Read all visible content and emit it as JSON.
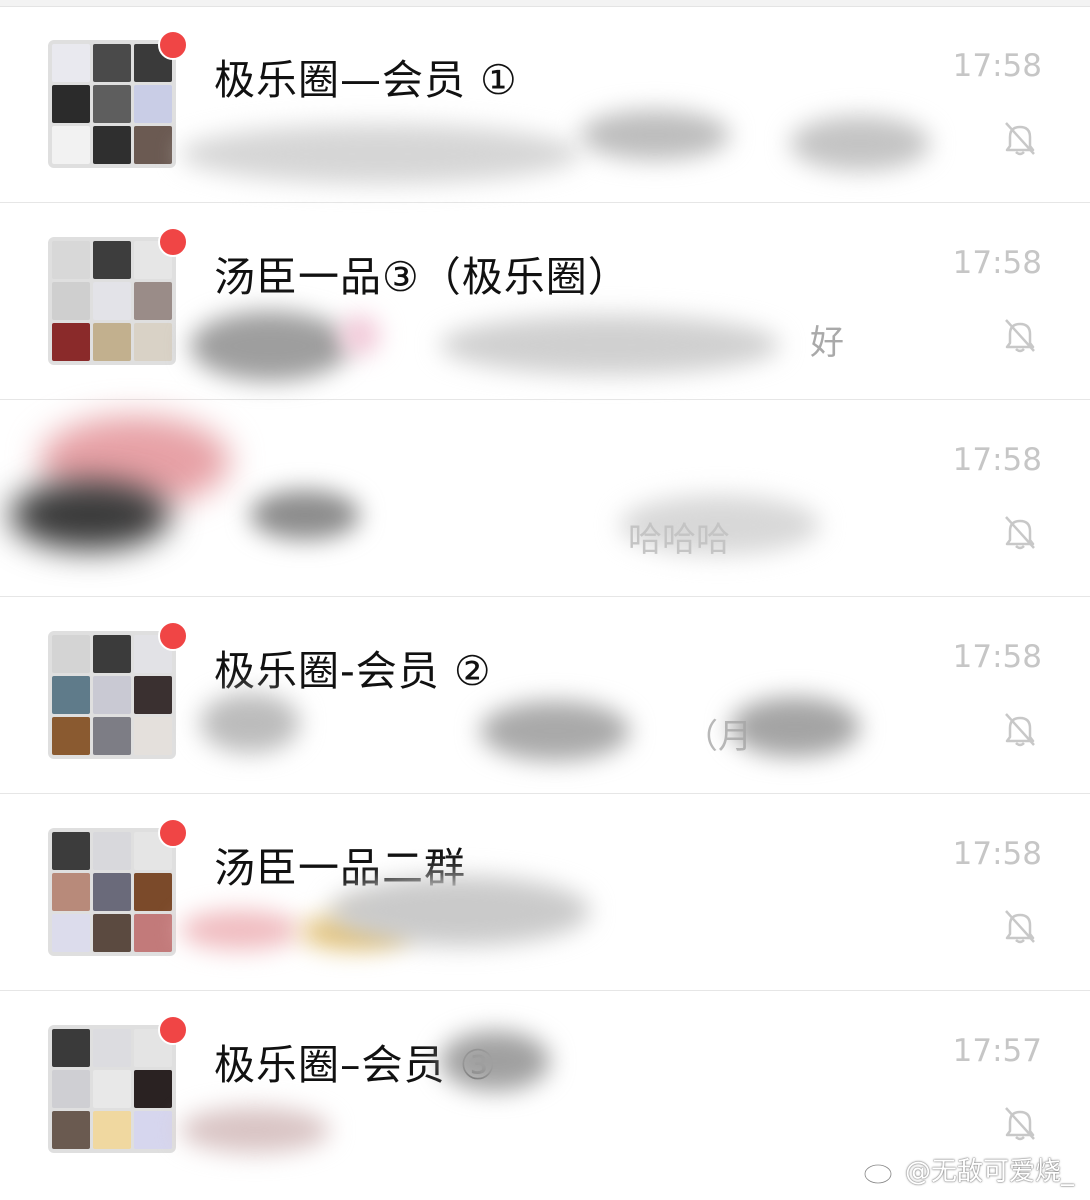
{
  "chats": [
    {
      "title": "极乐圈—会员 ①",
      "time": "17:58",
      "preview": "",
      "unread": true,
      "muted": true
    },
    {
      "title": "汤臣一品③（极乐圈）",
      "time": "17:58",
      "preview": "好",
      "unread": true,
      "muted": true
    },
    {
      "title": "",
      "time": "17:58",
      "preview": "哈哈哈",
      "unread": true,
      "muted": true
    },
    {
      "title": "极乐圈-会员 ②",
      "time": "17:58",
      "preview": "（月",
      "unread": true,
      "muted": true
    },
    {
      "title": "汤臣一品二群",
      "time": "17:58",
      "preview": "",
      "unread": true,
      "muted": true
    },
    {
      "title": "极乐圈–会员 ③",
      "time": "17:57",
      "preview": "",
      "unread": true,
      "muted": true
    }
  ],
  "watermark": "@无敌可爱烧_",
  "colors": {
    "unread_dot": "#f04545",
    "time": "#c6c6c6",
    "divider": "#e6e6e6"
  },
  "icons": {
    "mute": "bell-slash-icon",
    "watermark": "weibo-icon"
  }
}
